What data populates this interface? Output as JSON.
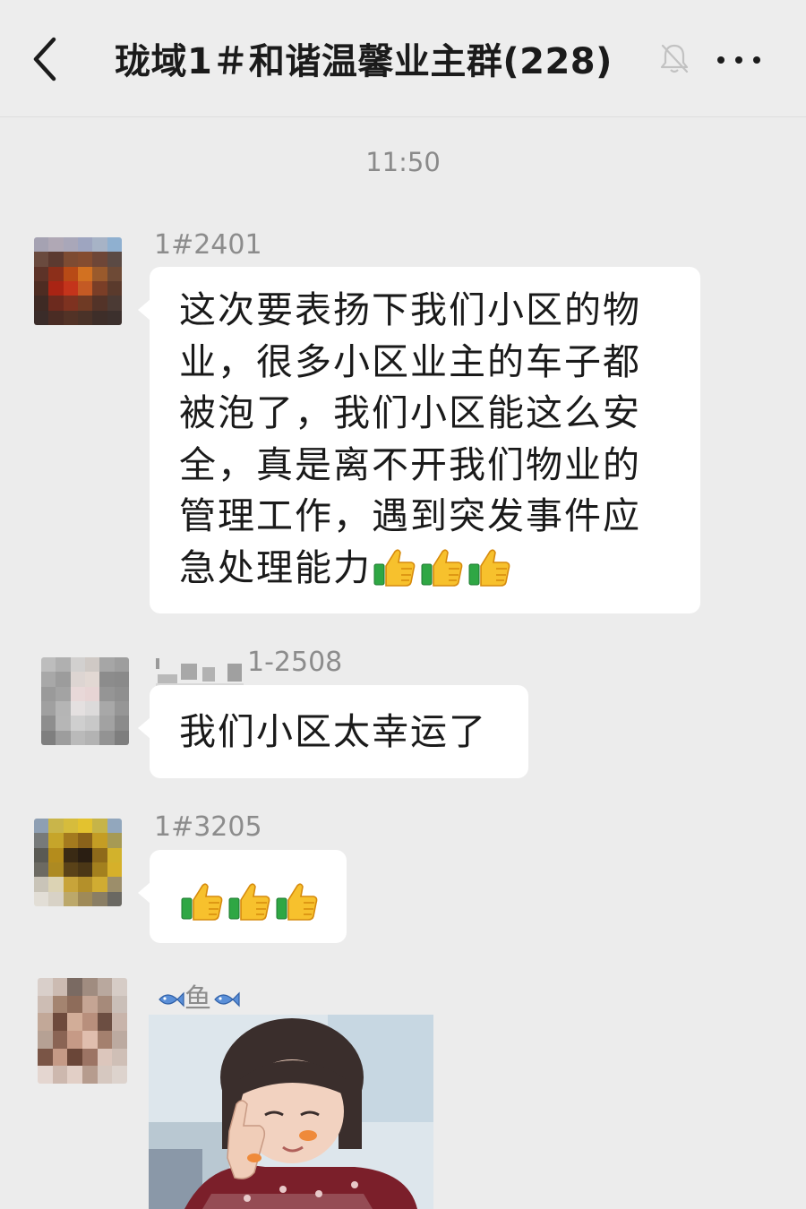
{
  "header": {
    "title": "珑域1＃和谐温馨业主群(228)",
    "back_icon": "chevron-left-icon",
    "mute_icon": "bell-muted-icon",
    "more_icon": "more-dots-icon"
  },
  "chat": {
    "timestamp": "11:50",
    "messages": [
      {
        "sender": "1#2401",
        "lines": [
          "这次要表扬下我们小区的物",
          "业，很多小区业主的车子都",
          "被泡了，我们小区能这么安",
          "全，真是离不开我们物业的",
          "管理工作，遇到突发事件应",
          "急处理能力"
        ],
        "emoji": "thumbs-up-icon"
      },
      {
        "sender_visible": "1-2508",
        "text": "我们小区太幸运了"
      },
      {
        "sender": "1#3205",
        "emoji": "thumbs-up-icon"
      },
      {
        "sender": "鱼",
        "sender_icon": "fish-icon",
        "sticker": "sticker-image"
      }
    ]
  },
  "colors": {
    "background": "#ececec",
    "bubble": "#ffffff",
    "sender": "#8c8c8c",
    "title": "#1b1b1b"
  }
}
